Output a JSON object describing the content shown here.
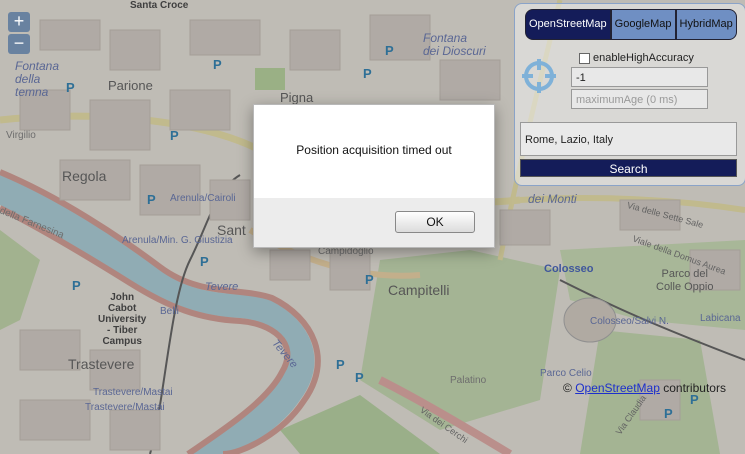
{
  "map": {
    "labels": {
      "santa_croce": "Santa\nCroce",
      "fontana_della_terma": "Fontana\ndella\ntemna",
      "parione": "Parione",
      "pigna": "Pigna",
      "fontana_dei_dioscuri": "Fontana\ndei Dioscuri",
      "virgilio": "Virgilio",
      "regola": "Regola",
      "arenula_cairoli": "Arenula/Cairoli",
      "arenula_min": "Arenula/Min. G. Giustizia",
      "sant": "Sant",
      "campidoglio": "Campidoglio",
      "campitelli": "Campitelli",
      "john_cabot": "John\nCabot\nUniversity\n- Tiber\nCampus",
      "trastevere": "Trastevere",
      "trastevere_mastai_1": "Trastevere/Mastai",
      "trastevere_mastai_2": "Trastevere/Mastai",
      "farnesina": "della Farnesina",
      "tevere": "Tevere",
      "tevere2": "Tevere",
      "belli": "Belli",
      "colosseo": "Colosseo",
      "colosseo_salvi": "Colosseo/Salvi N.",
      "parco_colle_oppio": "Parco del\nColle Oppio",
      "labicana": "Labicana",
      "palatino": "Palatino",
      "via_dei_cerchi": "Via dei Cerchi",
      "via_claudia": "Via Claudia",
      "parco_celio": "Parco Celio",
      "via_sette_sale": "Via delle Sette Sale",
      "via_monti": "dei Monti",
      "via_domus_aurea": "Viale della Domus Aurea"
    }
  },
  "zoom": {
    "in": "+",
    "out": "−"
  },
  "panel": {
    "tabs": [
      "OpenStreetMap",
      "GoogleMap",
      "HybridMap"
    ],
    "active_tab": "OpenStreetMap",
    "checkbox_label": "enableHighAccuracy",
    "timeout_value": "-1",
    "maximumage_placeholder": "maximumAge (0 ms)",
    "address_value": "Rome, Lazio, Italy",
    "search_label": "Search"
  },
  "attribution": {
    "prefix": "©",
    "link_text": "OpenStreetMap",
    "suffix": "contributors"
  },
  "dialog": {
    "message": "Position acquisition timed out",
    "ok_label": "OK"
  },
  "colors": {
    "dialog_bg": "#ececec",
    "search_button": "#141c59",
    "active_tab": "#141c59",
    "inactive_tab": "#6f8fc3",
    "river": "#aad3df"
  }
}
